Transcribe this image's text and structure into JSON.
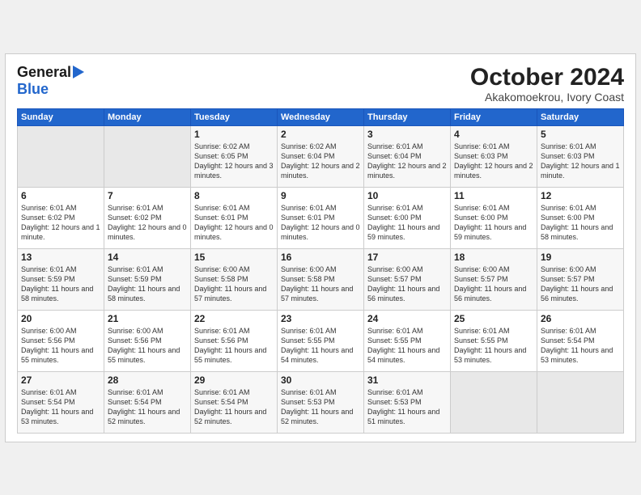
{
  "header": {
    "logo_general": "General",
    "logo_blue": "Blue",
    "title": "October 2024",
    "subtitle": "Akakomoekrou, Ivory Coast"
  },
  "weekdays": [
    "Sunday",
    "Monday",
    "Tuesday",
    "Wednesday",
    "Thursday",
    "Friday",
    "Saturday"
  ],
  "weeks": [
    [
      {
        "day": "",
        "info": ""
      },
      {
        "day": "",
        "info": ""
      },
      {
        "day": "1",
        "info": "Sunrise: 6:02 AM\nSunset: 6:05 PM\nDaylight: 12 hours and 3 minutes."
      },
      {
        "day": "2",
        "info": "Sunrise: 6:02 AM\nSunset: 6:04 PM\nDaylight: 12 hours and 2 minutes."
      },
      {
        "day": "3",
        "info": "Sunrise: 6:01 AM\nSunset: 6:04 PM\nDaylight: 12 hours and 2 minutes."
      },
      {
        "day": "4",
        "info": "Sunrise: 6:01 AM\nSunset: 6:03 PM\nDaylight: 12 hours and 2 minutes."
      },
      {
        "day": "5",
        "info": "Sunrise: 6:01 AM\nSunset: 6:03 PM\nDaylight: 12 hours and 1 minute."
      }
    ],
    [
      {
        "day": "6",
        "info": "Sunrise: 6:01 AM\nSunset: 6:02 PM\nDaylight: 12 hours and 1 minute."
      },
      {
        "day": "7",
        "info": "Sunrise: 6:01 AM\nSunset: 6:02 PM\nDaylight: 12 hours and 0 minutes."
      },
      {
        "day": "8",
        "info": "Sunrise: 6:01 AM\nSunset: 6:01 PM\nDaylight: 12 hours and 0 minutes."
      },
      {
        "day": "9",
        "info": "Sunrise: 6:01 AM\nSunset: 6:01 PM\nDaylight: 12 hours and 0 minutes."
      },
      {
        "day": "10",
        "info": "Sunrise: 6:01 AM\nSunset: 6:00 PM\nDaylight: 11 hours and 59 minutes."
      },
      {
        "day": "11",
        "info": "Sunrise: 6:01 AM\nSunset: 6:00 PM\nDaylight: 11 hours and 59 minutes."
      },
      {
        "day": "12",
        "info": "Sunrise: 6:01 AM\nSunset: 6:00 PM\nDaylight: 11 hours and 58 minutes."
      }
    ],
    [
      {
        "day": "13",
        "info": "Sunrise: 6:01 AM\nSunset: 5:59 PM\nDaylight: 11 hours and 58 minutes."
      },
      {
        "day": "14",
        "info": "Sunrise: 6:01 AM\nSunset: 5:59 PM\nDaylight: 11 hours and 58 minutes."
      },
      {
        "day": "15",
        "info": "Sunrise: 6:00 AM\nSunset: 5:58 PM\nDaylight: 11 hours and 57 minutes."
      },
      {
        "day": "16",
        "info": "Sunrise: 6:00 AM\nSunset: 5:58 PM\nDaylight: 11 hours and 57 minutes."
      },
      {
        "day": "17",
        "info": "Sunrise: 6:00 AM\nSunset: 5:57 PM\nDaylight: 11 hours and 56 minutes."
      },
      {
        "day": "18",
        "info": "Sunrise: 6:00 AM\nSunset: 5:57 PM\nDaylight: 11 hours and 56 minutes."
      },
      {
        "day": "19",
        "info": "Sunrise: 6:00 AM\nSunset: 5:57 PM\nDaylight: 11 hours and 56 minutes."
      }
    ],
    [
      {
        "day": "20",
        "info": "Sunrise: 6:00 AM\nSunset: 5:56 PM\nDaylight: 11 hours and 55 minutes."
      },
      {
        "day": "21",
        "info": "Sunrise: 6:00 AM\nSunset: 5:56 PM\nDaylight: 11 hours and 55 minutes."
      },
      {
        "day": "22",
        "info": "Sunrise: 6:01 AM\nSunset: 5:56 PM\nDaylight: 11 hours and 55 minutes."
      },
      {
        "day": "23",
        "info": "Sunrise: 6:01 AM\nSunset: 5:55 PM\nDaylight: 11 hours and 54 minutes."
      },
      {
        "day": "24",
        "info": "Sunrise: 6:01 AM\nSunset: 5:55 PM\nDaylight: 11 hours and 54 minutes."
      },
      {
        "day": "25",
        "info": "Sunrise: 6:01 AM\nSunset: 5:55 PM\nDaylight: 11 hours and 53 minutes."
      },
      {
        "day": "26",
        "info": "Sunrise: 6:01 AM\nSunset: 5:54 PM\nDaylight: 11 hours and 53 minutes."
      }
    ],
    [
      {
        "day": "27",
        "info": "Sunrise: 6:01 AM\nSunset: 5:54 PM\nDaylight: 11 hours and 53 minutes."
      },
      {
        "day": "28",
        "info": "Sunrise: 6:01 AM\nSunset: 5:54 PM\nDaylight: 11 hours and 52 minutes."
      },
      {
        "day": "29",
        "info": "Sunrise: 6:01 AM\nSunset: 5:54 PM\nDaylight: 11 hours and 52 minutes."
      },
      {
        "day": "30",
        "info": "Sunrise: 6:01 AM\nSunset: 5:53 PM\nDaylight: 11 hours and 52 minutes."
      },
      {
        "day": "31",
        "info": "Sunrise: 6:01 AM\nSunset: 5:53 PM\nDaylight: 11 hours and 51 minutes."
      },
      {
        "day": "",
        "info": ""
      },
      {
        "day": "",
        "info": ""
      }
    ]
  ]
}
